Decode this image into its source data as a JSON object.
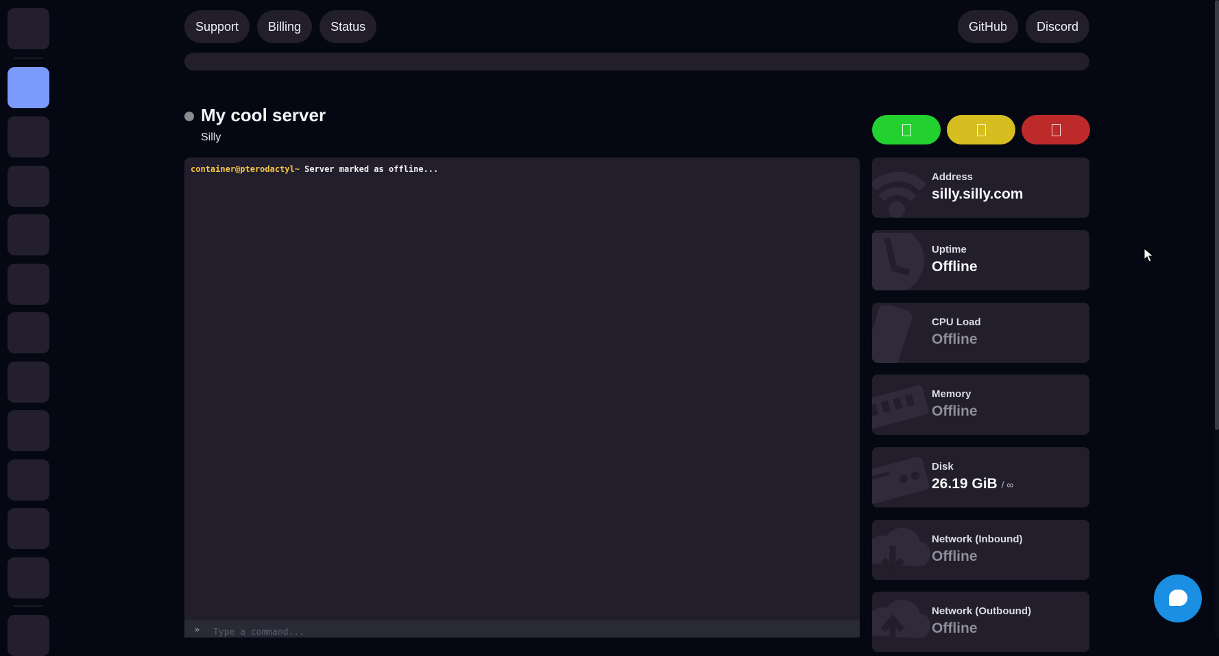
{
  "nav": {
    "left": [
      "Support",
      "Billing",
      "Status"
    ],
    "right": [
      "GitHub",
      "Discord"
    ]
  },
  "server": {
    "name": "My cool server",
    "subtitle": "Silly",
    "status_color": "#8a8a90"
  },
  "power": {
    "start_color": "#22d12f",
    "restart_color": "#d6bd20",
    "stop_color": "#bd2a2a"
  },
  "console": {
    "prompt": "container@pterodactyl~",
    "message": " Server marked as offline...",
    "chevron": "»",
    "input_placeholder": "Type a command..."
  },
  "stats": [
    {
      "label": "Address",
      "value": "silly.silly.com",
      "icon": "wifi-icon"
    },
    {
      "label": "Uptime",
      "value": "Offline",
      "icon": "clock-icon"
    },
    {
      "label": "CPU Load",
      "value": "Offline",
      "icon": "cpu-icon"
    },
    {
      "label": "Memory",
      "value": "Offline",
      "icon": "memory-icon"
    },
    {
      "label": "Disk",
      "value": "26.19 GiB",
      "suffix": "/ ∞",
      "icon": "hdd-icon"
    },
    {
      "label": "Network (Inbound)",
      "value": "Offline",
      "icon": "cloud-download-icon"
    },
    {
      "label": "Network (Outbound)",
      "value": "Offline",
      "icon": "cloud-upload-icon"
    }
  ],
  "colors": {
    "background": "#050812",
    "panel": "#221e2c",
    "accent": "#7a9bfd",
    "chat": "#1a8fe3"
  }
}
